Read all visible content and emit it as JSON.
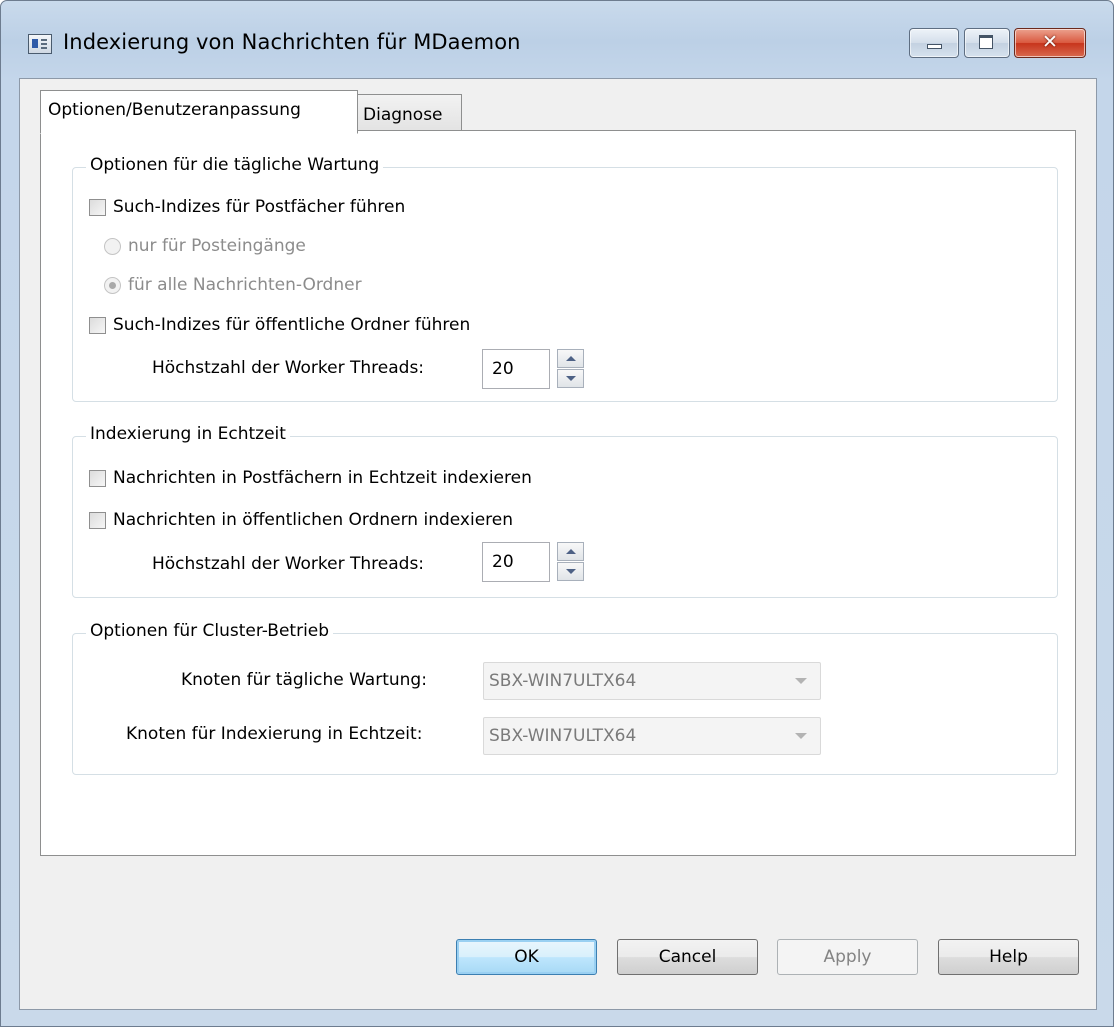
{
  "window": {
    "title": "Indexierung von Nachrichten für MDaemon",
    "close_glyph": "✕"
  },
  "tabs": [
    {
      "label": "Optionen/Benutzeranpassung",
      "active": true
    },
    {
      "label": "Diagnose",
      "active": false
    }
  ],
  "daily_maintenance": {
    "legend": "Optionen für die tägliche Wartung",
    "mailbox_index_label": "Such-Indizes für Postfächer führen",
    "mailbox_index_checked": false,
    "radio_inbox_only_label": "nur für Posteingänge",
    "radio_all_folders_label": "für alle Nachrichten-Ordner",
    "radio_selected": "all_folders",
    "public_index_label": "Such-Indizes für öffentliche Ordner führen",
    "public_index_checked": false,
    "max_threads_label": "Höchstzahl der Worker Threads:",
    "max_threads_value": "20"
  },
  "realtime": {
    "legend": "Indexierung in Echtzeit",
    "mailbox_realtime_label": "Nachrichten in Postfächern in Echtzeit indexieren",
    "mailbox_realtime_checked": false,
    "public_realtime_label": "Nachrichten in öffentlichen Ordnern indexieren",
    "public_realtime_checked": false,
    "max_threads_label": "Höchstzahl der Worker Threads:",
    "max_threads_value": "20"
  },
  "cluster": {
    "legend": "Optionen für Cluster-Betrieb",
    "daily_node_label": "Knoten für tägliche Wartung:",
    "daily_node_value": "SBX-WIN7ULTX64",
    "realtime_node_label": "Knoten für Indexierung in Echtzeit:",
    "realtime_node_value": "SBX-WIN7ULTX64"
  },
  "buttons": {
    "ok": "OK",
    "cancel": "Cancel",
    "apply": "Apply",
    "help": "Help"
  }
}
